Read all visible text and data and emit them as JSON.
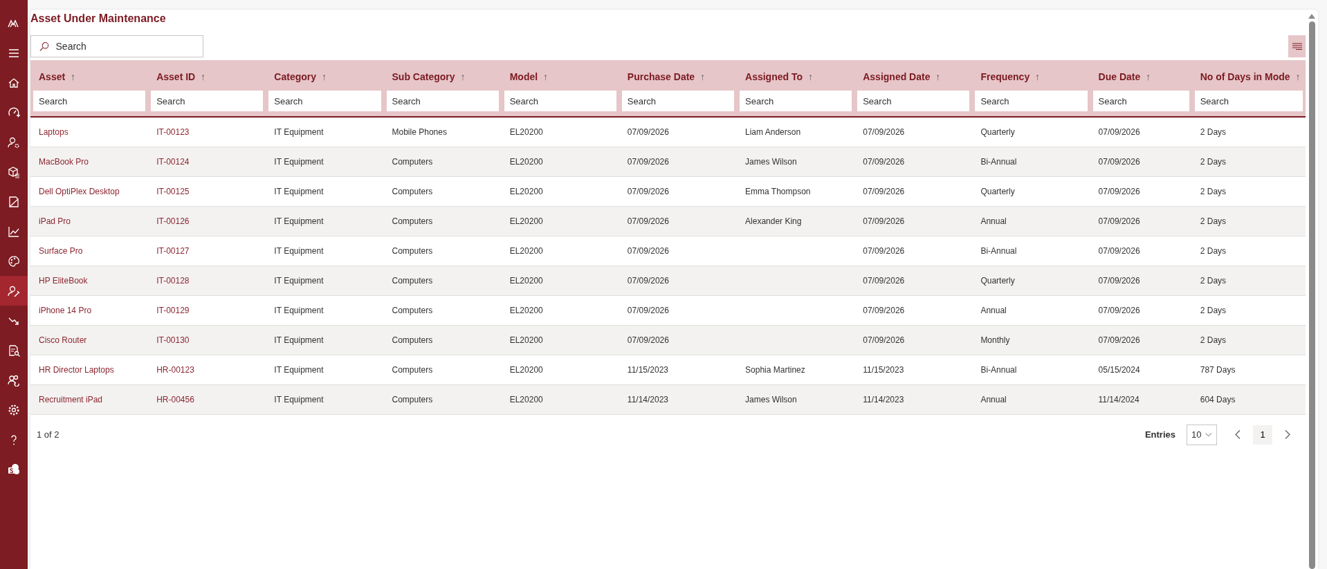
{
  "sidebar": {
    "items": [
      {
        "kind": "logo",
        "selected": false
      },
      {
        "kind": "menu",
        "selected": false
      },
      {
        "kind": "home",
        "selected": false
      },
      {
        "kind": "gauge",
        "selected": false
      },
      {
        "kind": "user-gear",
        "selected": false
      },
      {
        "kind": "boxes",
        "selected": false
      },
      {
        "kind": "document",
        "selected": false
      },
      {
        "kind": "chart",
        "selected": false
      },
      {
        "kind": "palette",
        "selected": false
      },
      {
        "kind": "user-wrench",
        "selected": true
      },
      {
        "kind": "trend-down",
        "selected": false
      },
      {
        "kind": "report",
        "selected": false
      },
      {
        "kind": "users",
        "selected": false
      },
      {
        "kind": "settings",
        "selected": false
      },
      {
        "kind": "help",
        "selected": false
      },
      {
        "kind": "share",
        "selected": false
      }
    ]
  },
  "page": {
    "title": "Asset Under Maintenance",
    "search": {
      "placeholder": "Search"
    }
  },
  "table": {
    "columns": [
      {
        "label": "Asset",
        "sort_mark": "↑",
        "filter_placeholder": "Search",
        "link": true
      },
      {
        "label": "Asset ID",
        "sort_mark": "↑",
        "filter_placeholder": "Search",
        "link": true
      },
      {
        "label": "Category",
        "sort_mark": "↑",
        "filter_placeholder": "Search",
        "link": false
      },
      {
        "label": "Sub Category",
        "sort_mark": "↑",
        "filter_placeholder": "Search",
        "link": false
      },
      {
        "label": "Model",
        "sort_mark": "↑",
        "filter_placeholder": "Search",
        "link": false
      },
      {
        "label": "Purchase Date",
        "sort_mark": "↑",
        "filter_placeholder": "Search",
        "link": false
      },
      {
        "label": "Assigned To",
        "sort_mark": "↑",
        "filter_placeholder": "Search",
        "link": false
      },
      {
        "label": "Assigned Date",
        "sort_mark": "↑",
        "filter_placeholder": "Search",
        "link": false
      },
      {
        "label": "Frequency",
        "sort_mark": "↑",
        "filter_placeholder": "Search",
        "link": false
      },
      {
        "label": "Due Date",
        "sort_mark": "↑",
        "filter_placeholder": "Search",
        "link": false
      },
      {
        "label": "No of Days in Mode",
        "sort_mark": "↑",
        "filter_placeholder": "Search",
        "link": false
      }
    ],
    "rows": [
      [
        "Laptops",
        "IT-00123",
        "IT Equipment",
        "Mobile Phones",
        "EL20200",
        "07/09/2026",
        "Liam Anderson",
        "07/09/2026",
        "Quarterly",
        "07/09/2026",
        "2 Days"
      ],
      [
        "MacBook Pro",
        "IT-00124",
        "IT Equipment",
        "Computers",
        "EL20200",
        "07/09/2026",
        "James Wilson",
        "07/09/2026",
        "Bi-Annual",
        "07/09/2026",
        "2 Days"
      ],
      [
        "Dell OptiPlex Desktop",
        "IT-00125",
        "IT Equipment",
        "Computers",
        "EL20200",
        "07/09/2026",
        "Emma Thompson",
        "07/09/2026",
        "Quarterly",
        "07/09/2026",
        "2 Days"
      ],
      [
        "iPad Pro",
        "IT-00126",
        "IT Equipment",
        "Computers",
        "EL20200",
        "07/09/2026",
        "Alexander King",
        "07/09/2026",
        "Annual",
        "07/09/2026",
        "2 Days"
      ],
      [
        "Surface Pro",
        "IT-00127",
        "IT Equipment",
        "Computers",
        "EL20200",
        "07/09/2026",
        null,
        "07/09/2026",
        "Bi-Annual",
        "07/09/2026",
        "2 Days"
      ],
      [
        "HP EliteBook",
        "IT-00128",
        "IT Equipment",
        "Computers",
        "EL20200",
        "07/09/2026",
        null,
        "07/09/2026",
        "Quarterly",
        "07/09/2026",
        "2 Days"
      ],
      [
        "iPhone 14 Pro",
        "IT-00129",
        "IT Equipment",
        "Computers",
        "EL20200",
        "07/09/2026",
        null,
        "07/09/2026",
        "Annual",
        "07/09/2026",
        "2 Days"
      ],
      [
        "Cisco Router",
        "IT-00130",
        "IT Equipment",
        "Computers",
        "EL20200",
        "07/09/2026",
        null,
        "07/09/2026",
        "Monthly",
        "07/09/2026",
        "2 Days"
      ],
      [
        "HR Director Laptops",
        "HR-00123",
        "IT Equipment",
        "Computers",
        "EL20200",
        "11/15/2023",
        "Sophia Martinez",
        "11/15/2023",
        "Bi-Annual",
        "05/15/2024",
        "787 Days"
      ],
      [
        "Recruitment iPad",
        "HR-00456",
        "IT Equipment",
        "Computers",
        "EL20200",
        "11/14/2023",
        "James Wilson",
        "11/14/2023",
        "Annual",
        "11/14/2024",
        "604 Days"
      ]
    ]
  },
  "footer": {
    "page_info": "1 of 2",
    "entries_label": "Entries",
    "entries_value": "10",
    "pages": [
      {
        "label": "1",
        "selected": true
      }
    ]
  }
}
